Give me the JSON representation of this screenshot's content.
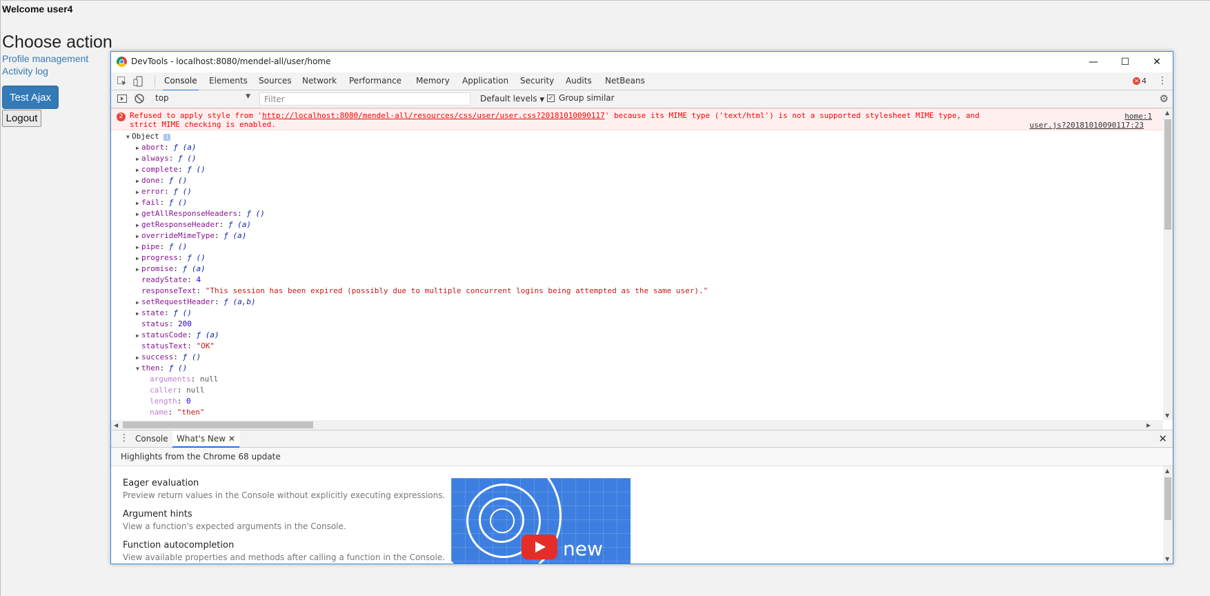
{
  "page": {
    "welcome": "Welcome user4",
    "heading": "Choose action",
    "links": [
      "Profile management",
      "Activity log"
    ],
    "test_button": "Test Ajax",
    "logout_button": "Logout"
  },
  "devtools": {
    "window_title": "DevTools - localhost:8080/mendel-all/user/home",
    "window_controls": {
      "minimize": "—",
      "maximize": "☐",
      "close": "✕"
    },
    "tabs": [
      "Console",
      "Elements",
      "Sources",
      "Network",
      "Performance",
      "Memory",
      "Application",
      "Security",
      "Audits",
      "NetBeans"
    ],
    "active_tab": "Console",
    "error_count": "4",
    "toolbar": {
      "context": "top",
      "filter_placeholder": "Filter",
      "levels": "Default levels",
      "group_similar": "Group similar"
    },
    "error_message": {
      "count": "2",
      "prefix": "Refused to apply style from '",
      "url": "http://localhost:8080/mendel-all/resources/css/user/user.css?20181010090117",
      "suffix": "' because its MIME type ('text/html') is not a supported stylesheet MIME type, and strict MIME checking is enabled.",
      "source": "home:1"
    },
    "log_source": "user.js?20181010090117:23",
    "object_label": "Object",
    "object_info_badge": "i",
    "properties": [
      {
        "key": "abort",
        "value": "ƒ (a)",
        "expandable": true,
        "type": "fn"
      },
      {
        "key": "always",
        "value": "ƒ ()",
        "expandable": true,
        "type": "fn"
      },
      {
        "key": "complete",
        "value": "ƒ ()",
        "expandable": true,
        "type": "fn"
      },
      {
        "key": "done",
        "value": "ƒ ()",
        "expandable": true,
        "type": "fn"
      },
      {
        "key": "error",
        "value": "ƒ ()",
        "expandable": true,
        "type": "fn"
      },
      {
        "key": "fail",
        "value": "ƒ ()",
        "expandable": true,
        "type": "fn"
      },
      {
        "key": "getAllResponseHeaders",
        "value": "ƒ ()",
        "expandable": true,
        "type": "fn"
      },
      {
        "key": "getResponseHeader",
        "value": "ƒ (a)",
        "expandable": true,
        "type": "fn"
      },
      {
        "key": "overrideMimeType",
        "value": "ƒ (a)",
        "expandable": true,
        "type": "fn"
      },
      {
        "key": "pipe",
        "value": "ƒ ()",
        "expandable": true,
        "type": "fn"
      },
      {
        "key": "progress",
        "value": "ƒ ()",
        "expandable": true,
        "type": "fn"
      },
      {
        "key": "promise",
        "value": "ƒ (a)",
        "expandable": true,
        "type": "fn"
      },
      {
        "key": "readyState",
        "value": "4",
        "expandable": false,
        "type": "num"
      },
      {
        "key": "responseText",
        "value": "\"This session has been expired (possibly due to multiple concurrent logins being attempted as the same user).\"",
        "expandable": false,
        "type": "str"
      },
      {
        "key": "setRequestHeader",
        "value": "ƒ (a,b)",
        "expandable": true,
        "type": "fn"
      },
      {
        "key": "state",
        "value": "ƒ ()",
        "expandable": true,
        "type": "fn"
      },
      {
        "key": "status",
        "value": "200",
        "expandable": false,
        "type": "num"
      },
      {
        "key": "statusCode",
        "value": "ƒ (a)",
        "expandable": true,
        "type": "fn"
      },
      {
        "key": "statusText",
        "value": "\"OK\"",
        "expandable": false,
        "type": "str"
      },
      {
        "key": "success",
        "value": "ƒ ()",
        "expandable": true,
        "type": "fn"
      },
      {
        "key": "then",
        "value": "ƒ ()",
        "expandable": true,
        "expanded": true,
        "type": "fn"
      }
    ],
    "then_children": [
      {
        "key": "arguments",
        "value": "null",
        "type": "nul"
      },
      {
        "key": "caller",
        "value": "null",
        "type": "nul"
      },
      {
        "key": "length",
        "value": "0",
        "type": "num"
      },
      {
        "key": "name",
        "value": "\"then\"",
        "type": "str"
      }
    ],
    "drawer": {
      "tabs": [
        "Console",
        "What's New"
      ],
      "active_tab": "What's New",
      "heading": "Highlights from the Chrome 68 update",
      "features": [
        {
          "title": "Eager evaluation",
          "description": "Preview return values in the Console without explicitly executing expressions."
        },
        {
          "title": "Argument hints",
          "description": "View a function's expected arguments in the Console."
        },
        {
          "title": "Function autocompletion",
          "description": "View available properties and methods after calling a function in the Console."
        }
      ],
      "promo_text": "new"
    }
  }
}
